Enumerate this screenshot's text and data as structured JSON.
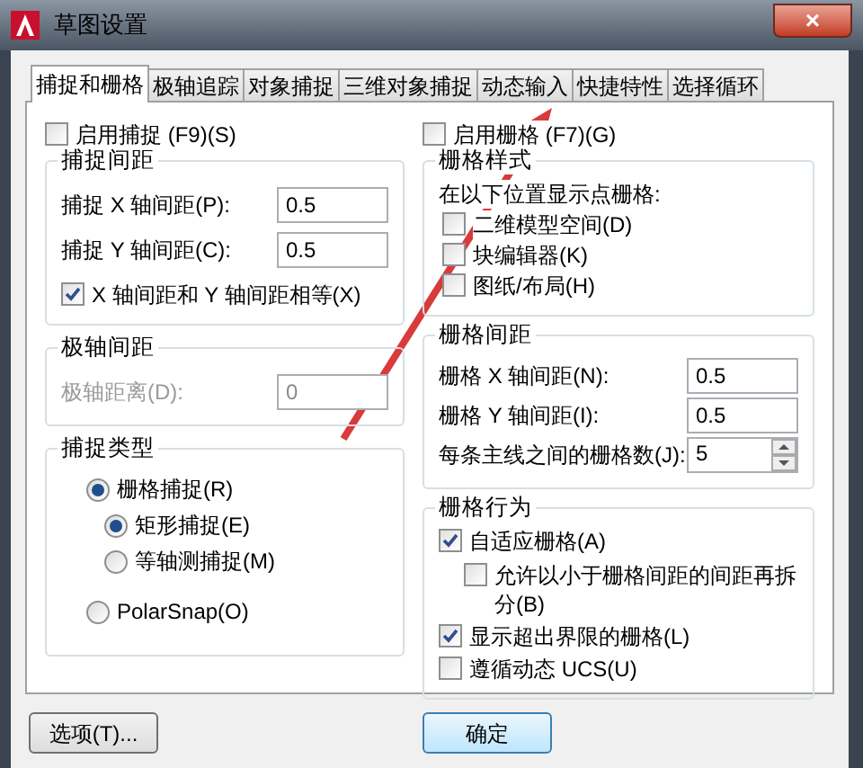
{
  "window": {
    "title": "草图设置",
    "close": "×"
  },
  "tabs": [
    {
      "label": "捕捉和栅格",
      "selected": true
    },
    {
      "label": "极轴追踪",
      "selected": false
    },
    {
      "label": "对象捕捉",
      "selected": false
    },
    {
      "label": "三维对象捕捉",
      "selected": false
    },
    {
      "label": "动态输入",
      "selected": false
    },
    {
      "label": "快捷特性",
      "selected": false
    },
    {
      "label": "选择循环",
      "selected": false
    }
  ],
  "snap_on": {
    "label": "启用捕捉 (F9)(S)",
    "checked": false
  },
  "snap_spacing": {
    "title": "捕捉间距",
    "fields": [
      {
        "label": "捕捉 X 轴间距(P):",
        "value": "0.5"
      },
      {
        "label": "捕捉 Y 轴间距(C):",
        "value": "0.5"
      }
    ],
    "equal": {
      "label": "X 轴间距和 Y 轴间距相等(X)",
      "checked": true
    }
  },
  "polar_spacing": {
    "title": "极轴间距",
    "field": {
      "label": "极轴距离(D):",
      "value": "0",
      "disabled": true
    }
  },
  "snap_type": {
    "title": "捕捉类型",
    "options": [
      {
        "label": "栅格捕捉(R)",
        "selected": true,
        "children": [
          {
            "label": "矩形捕捉(E)",
            "selected": true
          },
          {
            "label": "等轴测捕捉(M)",
            "selected": false
          }
        ]
      },
      {
        "label": "PolarSnap(O)",
        "selected": false
      }
    ]
  },
  "grid_on": {
    "label": "启用栅格 (F7)(G)",
    "checked": false
  },
  "grid_style": {
    "title": "栅格样式",
    "caption": "在以下位置显示点栅格:",
    "options": [
      {
        "label": "二维模型空间(D)",
        "checked": false
      },
      {
        "label": "块编辑器(K)",
        "checked": false
      },
      {
        "label": "图纸/布局(H)",
        "checked": false
      }
    ]
  },
  "grid_spacing": {
    "title": "栅格间距",
    "fields": [
      {
        "label": "栅格 X 轴间距(N):",
        "value": "0.5",
        "kind": "text"
      },
      {
        "label": "栅格 Y 轴间距(I):",
        "value": "0.5",
        "kind": "text"
      },
      {
        "label": "每条主线之间的栅格数(J):",
        "value": "5",
        "kind": "spinner"
      }
    ]
  },
  "grid_behavior": {
    "title": "栅格行为",
    "options": [
      {
        "label": "自适应栅格(A)",
        "checked": true,
        "children": [
          {
            "label": "允许以小于栅格间距的间距再拆分(B)",
            "checked": false
          }
        ]
      },
      {
        "label": "显示超出界限的栅格(L)",
        "checked": true
      },
      {
        "label": "遵循动态 UCS(U)",
        "checked": false
      }
    ]
  },
  "buttons": [
    {
      "label": "选项(T)...",
      "kind": "options"
    },
    {
      "label": "确定",
      "kind": "ok"
    }
  ]
}
